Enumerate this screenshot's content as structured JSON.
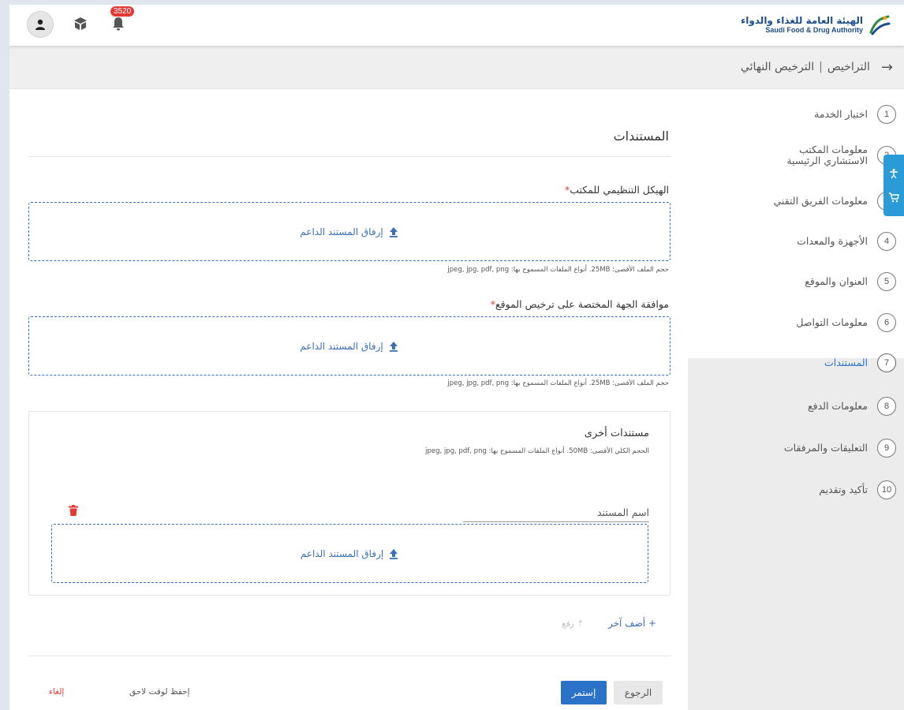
{
  "header": {
    "logo_ar": "الهيئة العامة للغذاء والدواء",
    "logo_en": "Saudi Food & Drug Authority",
    "notification_count": "3520"
  },
  "breadcrumb": {
    "parent": "التراخيص",
    "separator": "|",
    "current": "الترخيص النهائي"
  },
  "steps": [
    {
      "num": "1",
      "label": "اختيار الخدمة"
    },
    {
      "num": "2",
      "label": "معلومات المكتب الاستشاري الرئيسية"
    },
    {
      "num": "3",
      "label": "معلومات الفريق التقني"
    },
    {
      "num": "4",
      "label": "الأجهزة والمعدات"
    },
    {
      "num": "5",
      "label": "العنوان والموقع"
    },
    {
      "num": "6",
      "label": "معلومات التواصل"
    },
    {
      "num": "7",
      "label": "المستندات"
    },
    {
      "num": "8",
      "label": "معلومات الدفع"
    },
    {
      "num": "9",
      "label": "التعليقات والمرفقات"
    },
    {
      "num": "10",
      "label": "تأكيد وتقديم"
    }
  ],
  "main": {
    "section_title": "المستندات",
    "fields": [
      {
        "label": "الهيكل التنظيمي للمكتب",
        "required_mark": "*",
        "upload_label": "إرفاق المستند الداعم",
        "hint": "حجم الملف الأقصى: 25MB. أنواع الملفات المسموح بها: jpeg, jpg, pdf, png"
      },
      {
        "label": "موافقة الجهة المختصة على ترخيص الموقع",
        "required_mark": "*",
        "upload_label": "إرفاق المستند الداعم",
        "hint": "حجم الملف الأقصى: 25MB. أنواع الملفات المسموح بها: jpeg, jpg, pdf, png"
      }
    ],
    "other_docs": {
      "title": "مستندات أخرى",
      "hint": "الحجم الكلي الأقصى: 50MB. أنواع الملفات المسموح بها: jpeg, jpg, pdf, png",
      "doc_name_placeholder": "اسم المستند",
      "upload_label": "إرفاق المستند الداعم"
    },
    "add_another": "+ أضف آخر",
    "upload": "رفع"
  },
  "footer": {
    "back": "الرجوع",
    "continue": "إستمر",
    "save_later": "إحفظ لوقت لاحق",
    "cancel": "إلغاء"
  },
  "colors": {
    "accent": "#2a73c9",
    "danger": "#e53935",
    "badge": "#e53935"
  }
}
